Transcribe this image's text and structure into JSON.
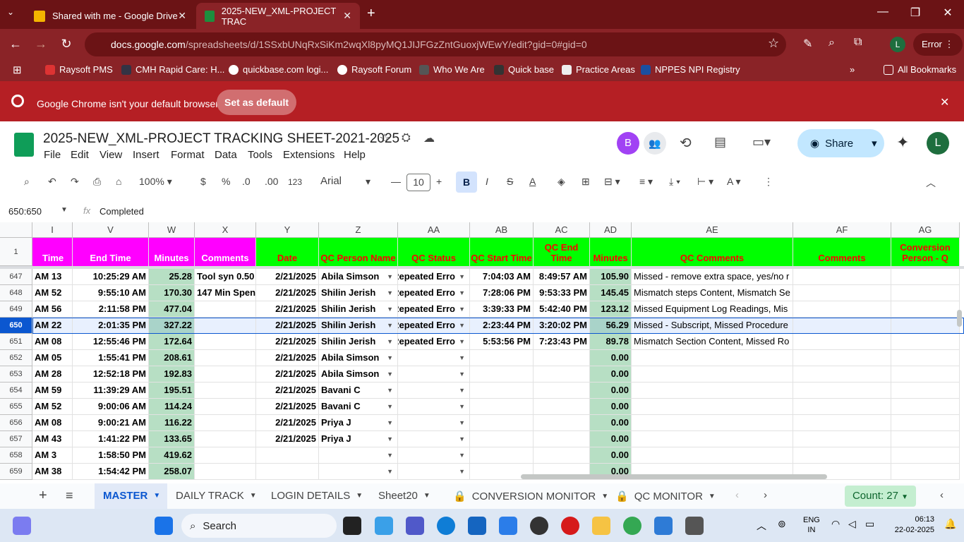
{
  "browser": {
    "tabs": [
      {
        "title": "Shared with me - Google Drive",
        "color": "#f4b400"
      },
      {
        "title": "2025-NEW_XML-PROJECT TRAC",
        "color": "#1e8e3e"
      }
    ],
    "url_host": "docs.google.com",
    "url_path": "/spreadsheets/d/1SSxbUNqRxSiKm2wqXl8pyMQ1JIJFGzZntGuoxjWEwY/edit?gid=0#gid=0",
    "profile": "L",
    "error_label": "Error",
    "bookmarks": [
      "Raysoft PMS",
      "CMH Rapid Care: H...",
      "quickbase.com logi...",
      "Raysoft Forum",
      "Who We Are",
      "Quick base",
      "Practice Areas",
      "NPPES NPI Registry"
    ],
    "all_bookmarks": "All Bookmarks",
    "infobar": {
      "message": "Google Chrome isn't your default browser",
      "button": "Set as default"
    }
  },
  "sheet": {
    "title": "2025-NEW_XML-PROJECT TRACKING SHEET-2021-2025",
    "menus": [
      "File",
      "Edit",
      "View",
      "Insert",
      "Format",
      "Data",
      "Tools",
      "Extensions",
      "Help"
    ],
    "share": "Share",
    "avatar_b": "B",
    "avatar_l": "L",
    "toolbar": {
      "zoom": "100%",
      "currency": "$",
      "percent": "%",
      "dec_less": ".0",
      "dec_more": ".00",
      "num_format": "123",
      "font": "Arial",
      "font_size": "10"
    },
    "name_box": "650:650",
    "formula": "Completed",
    "columns": [
      "I",
      "V",
      "W",
      "X",
      "Y",
      "Z",
      "AA",
      "AB",
      "AC",
      "AD",
      "AE",
      "AF",
      "AG"
    ],
    "headers": [
      "Time",
      "End Time",
      "Minutes",
      "Comments",
      "Date",
      "QC Person Name",
      "QC Status",
      "QC Start Time",
      "QC End Time",
      "Minutes",
      "QC Comments",
      "Comments",
      "Conversion Person - Q"
    ],
    "rows": [
      {
        "n": "647",
        "c": [
          "13 AM",
          "10:25:29 AM",
          "25.28",
          "Tool syn 0.50",
          "2/21/2025",
          "Abila Simson",
          "Repeated Erro",
          "7:04:03 AM",
          "8:49:57 AM",
          "105.90",
          "Missed - remove extra space, yes/no r",
          "",
          ""
        ]
      },
      {
        "n": "648",
        "c": [
          "52 AM",
          "9:55:10 AM",
          "170.30",
          "147 Min Spen",
          "2/21/2025",
          "Shilin Jerish",
          "Repeated Erro",
          "7:28:06 PM",
          "9:53:33 PM",
          "145.45",
          "Mismatch steps Content, Mismatch Se",
          "",
          ""
        ]
      },
      {
        "n": "649",
        "c": [
          "56 AM",
          "2:11:58 PM",
          "477.04",
          "",
          "2/21/2025",
          "Shilin Jerish",
          "Repeated Erro",
          "3:39:33 PM",
          "5:42:40 PM",
          "123.12",
          "Missed Equipment Log Readings, Mis",
          "",
          ""
        ]
      },
      {
        "n": "650",
        "c": [
          "22 AM",
          "2:01:35 PM",
          "327.22",
          "",
          "2/21/2025",
          "Shilin Jerish",
          "Repeated Erro",
          "2:23:44 PM",
          "3:20:02 PM",
          "56.29",
          "Missed - Subscript, Missed Procedure",
          "",
          ""
        ]
      },
      {
        "n": "651",
        "c": [
          "08 AM",
          "12:55:46 PM",
          "172.64",
          "",
          "2/21/2025",
          "Shilin Jerish",
          "Repeated Erro",
          "5:53:56 PM",
          "7:23:43 PM",
          "89.78",
          "Mismatch Section Content, Missed Ro",
          "",
          ""
        ]
      },
      {
        "n": "652",
        "c": [
          "05 AM",
          "1:55:41 PM",
          "208.61",
          "",
          "2/21/2025",
          "Abila Simson",
          "",
          "",
          "",
          "0.00",
          "",
          "",
          ""
        ]
      },
      {
        "n": "653",
        "c": [
          "28 AM",
          "12:52:18 PM",
          "192.83",
          "",
          "2/21/2025",
          "Abila Simson",
          "",
          "",
          "",
          "0.00",
          "",
          "",
          ""
        ]
      },
      {
        "n": "654",
        "c": [
          "59 AM",
          "11:39:29 AM",
          "195.51",
          "",
          "2/21/2025",
          "Bavani C",
          "",
          "",
          "",
          "0.00",
          "",
          "",
          ""
        ]
      },
      {
        "n": "655",
        "c": [
          "52 AM",
          "9:00:06 AM",
          "114.24",
          "",
          "2/21/2025",
          "Bavani C",
          "",
          "",
          "",
          "0.00",
          "",
          "",
          ""
        ]
      },
      {
        "n": "656",
        "c": [
          "08 AM",
          "9:00:21 AM",
          "116.22",
          "",
          "2/21/2025",
          "Priya J",
          "",
          "",
          "",
          "0.00",
          "",
          "",
          ""
        ]
      },
      {
        "n": "657",
        "c": [
          "43 AM",
          "1:41:22 PM",
          "133.65",
          "",
          "2/21/2025",
          "Priya J",
          "",
          "",
          "",
          "0.00",
          "",
          "",
          ""
        ]
      },
      {
        "n": "658",
        "c": [
          "3 AM",
          "1:58:50 PM",
          "419.62",
          "",
          "",
          "",
          "",
          "",
          "",
          "0.00",
          "",
          "",
          ""
        ]
      },
      {
        "n": "659",
        "c": [
          "38 AM",
          "1:54:42 PM",
          "258.07",
          "",
          "",
          "",
          "",
          "",
          "",
          "0.00",
          "",
          "",
          ""
        ]
      }
    ],
    "tabs": [
      "MASTER",
      "DAILY TRACK",
      "LOGIN DETAILS",
      "Sheet20",
      "CONVERSION MONITOR",
      "QC MONITOR"
    ],
    "count": "Count: 27"
  },
  "taskbar": {
    "search": "Search",
    "lang1": "ENG",
    "lang2": "IN",
    "time": "06:13",
    "date": "22-02-2025"
  },
  "colors": {
    "header_pink": "#ff00ff",
    "header_green": "#00ff00",
    "minutes_col": "#b7dfc4",
    "chrome_dark": "#6b1315",
    "chrome": "#8a2327",
    "infobar": "#b51f24"
  }
}
